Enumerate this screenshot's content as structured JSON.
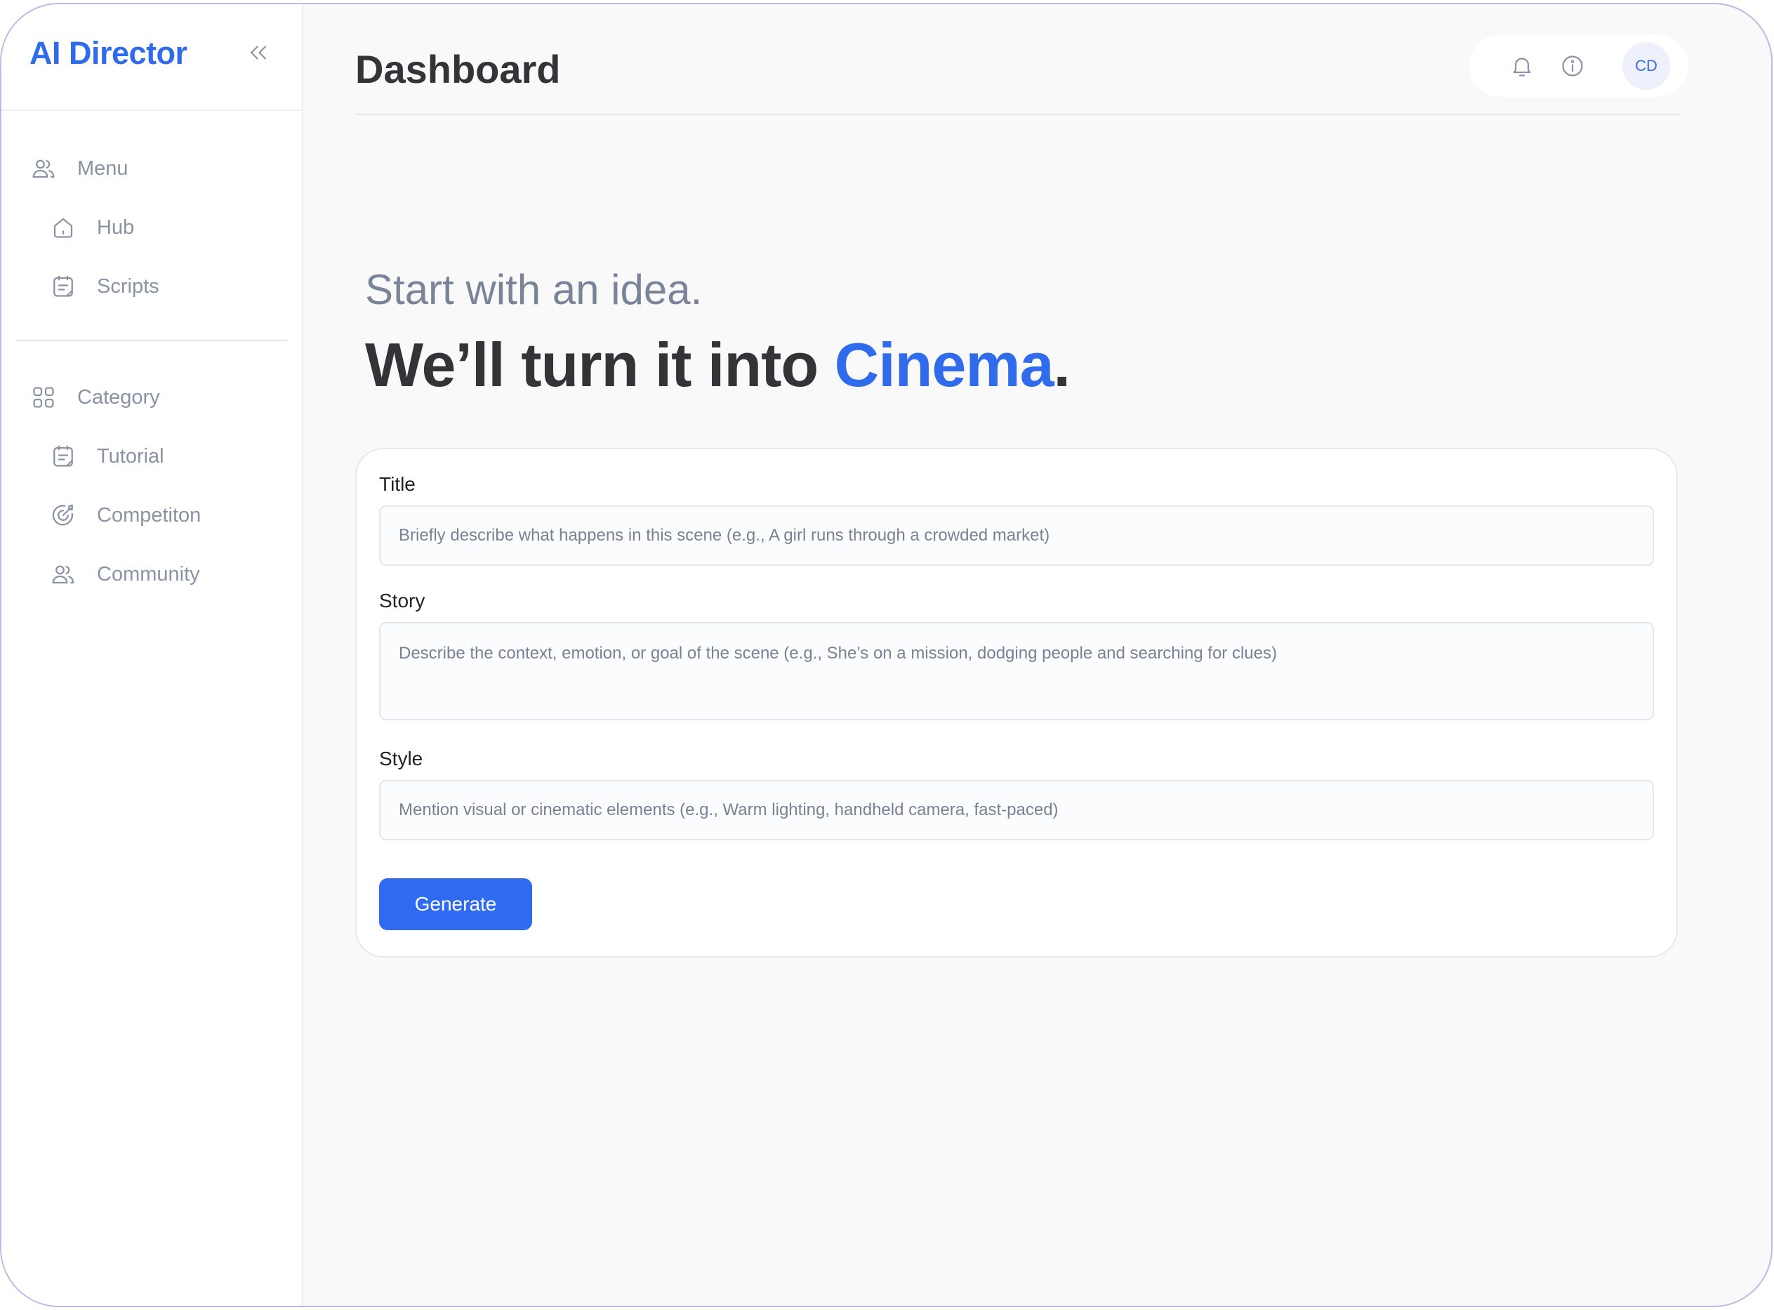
{
  "app": {
    "brand": "AI Director"
  },
  "sidebar": {
    "menu_heading": "Menu",
    "menu_items": [
      {
        "label": "Hub",
        "icon": "home-icon"
      },
      {
        "label": "Scripts",
        "icon": "notes-icon"
      }
    ],
    "category_heading": "Category",
    "category_items": [
      {
        "label": "Tutorial",
        "icon": "notes-icon"
      },
      {
        "label": "Competiton",
        "icon": "target-icon"
      },
      {
        "label": "Community",
        "icon": "users-icon"
      }
    ]
  },
  "header": {
    "title": "Dashboard",
    "avatar_initials": "CD"
  },
  "hero": {
    "subtitle": "Start with an idea.",
    "headline_prefix": "We’ll turn it into ",
    "headline_accent": "Cinema",
    "headline_suffix": "."
  },
  "form": {
    "title_label": "Title",
    "title_placeholder": "Briefly describe what happens in this scene (e.g., A girl runs through a crowded market)",
    "story_label": "Story",
    "story_placeholder": "Describe the context, emotion, or goal of the scene (e.g., She’s on a mission, dodging people and searching for clues)",
    "style_label": "Style",
    "style_placeholder": "Mention visual or cinematic elements (e.g., Warm lighting, handheld camera, fast-paced)",
    "submit_label": "Generate"
  },
  "colors": {
    "accent": "#2f6bea",
    "muted": "#8a93a6",
    "heading": "#333338"
  }
}
